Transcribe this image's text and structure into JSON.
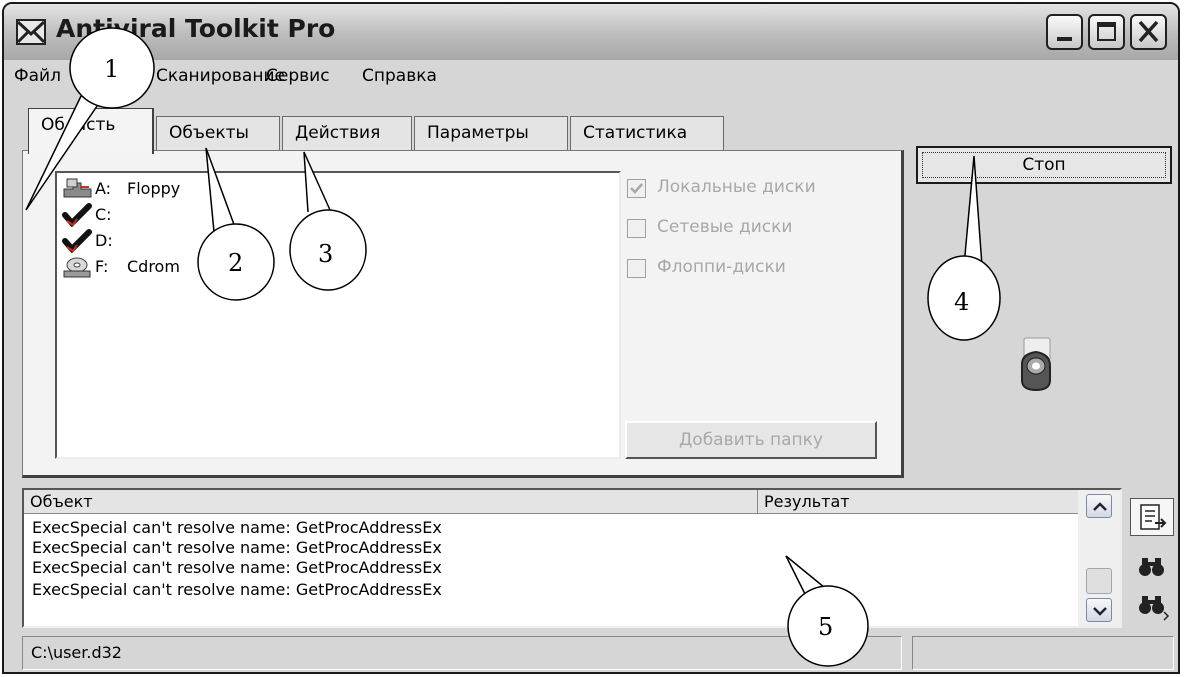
{
  "window": {
    "title": "Antiviral Toolkit Pro"
  },
  "menu": {
    "items": [
      "Файл",
      "Сканирование",
      "Сервис",
      "Справка"
    ]
  },
  "tabs": [
    {
      "label": "Область"
    },
    {
      "label": "Объекты"
    },
    {
      "label": "Действия"
    },
    {
      "label": "Параметры"
    },
    {
      "label": "Статистика"
    }
  ],
  "drives": [
    {
      "letter": "A:",
      "name": "Floppy",
      "icon": "floppy-drive-icon"
    },
    {
      "letter": "C:",
      "name": "",
      "icon": "checkmark-icon"
    },
    {
      "letter": "D:",
      "name": "",
      "icon": "checkmark-icon"
    },
    {
      "letter": "F:",
      "name": "Cdrom",
      "icon": "cdrom-drive-icon"
    }
  ],
  "options": [
    {
      "label": "Локальные диски",
      "checked": true
    },
    {
      "label": "Сетевые диски",
      "checked": false
    },
    {
      "label": "Флоппи-диски",
      "checked": false
    }
  ],
  "buttons": {
    "add_folder": "Добавить папку",
    "stop": "Стоп"
  },
  "log": {
    "columns": [
      "Объект",
      "Результат"
    ],
    "rows": [
      "ExecSpecial can't resolve name: GetProcAddressEx",
      "ExecSpecial can't resolve name: GetProcAddressEx",
      "ExecSpecial can't resolve name: GetProcAddressEx",
      "ExecSpecial can't resolve name: GetProcAddressEx"
    ]
  },
  "status": {
    "path": "C:\\user.d32",
    "right": ""
  },
  "annotations": [
    "1",
    "2",
    "3",
    "4",
    "5"
  ],
  "colors": {
    "window_bg": "#d6d6d6",
    "disabled_text": "#a8a8a8",
    "check_red": "#c83020"
  }
}
